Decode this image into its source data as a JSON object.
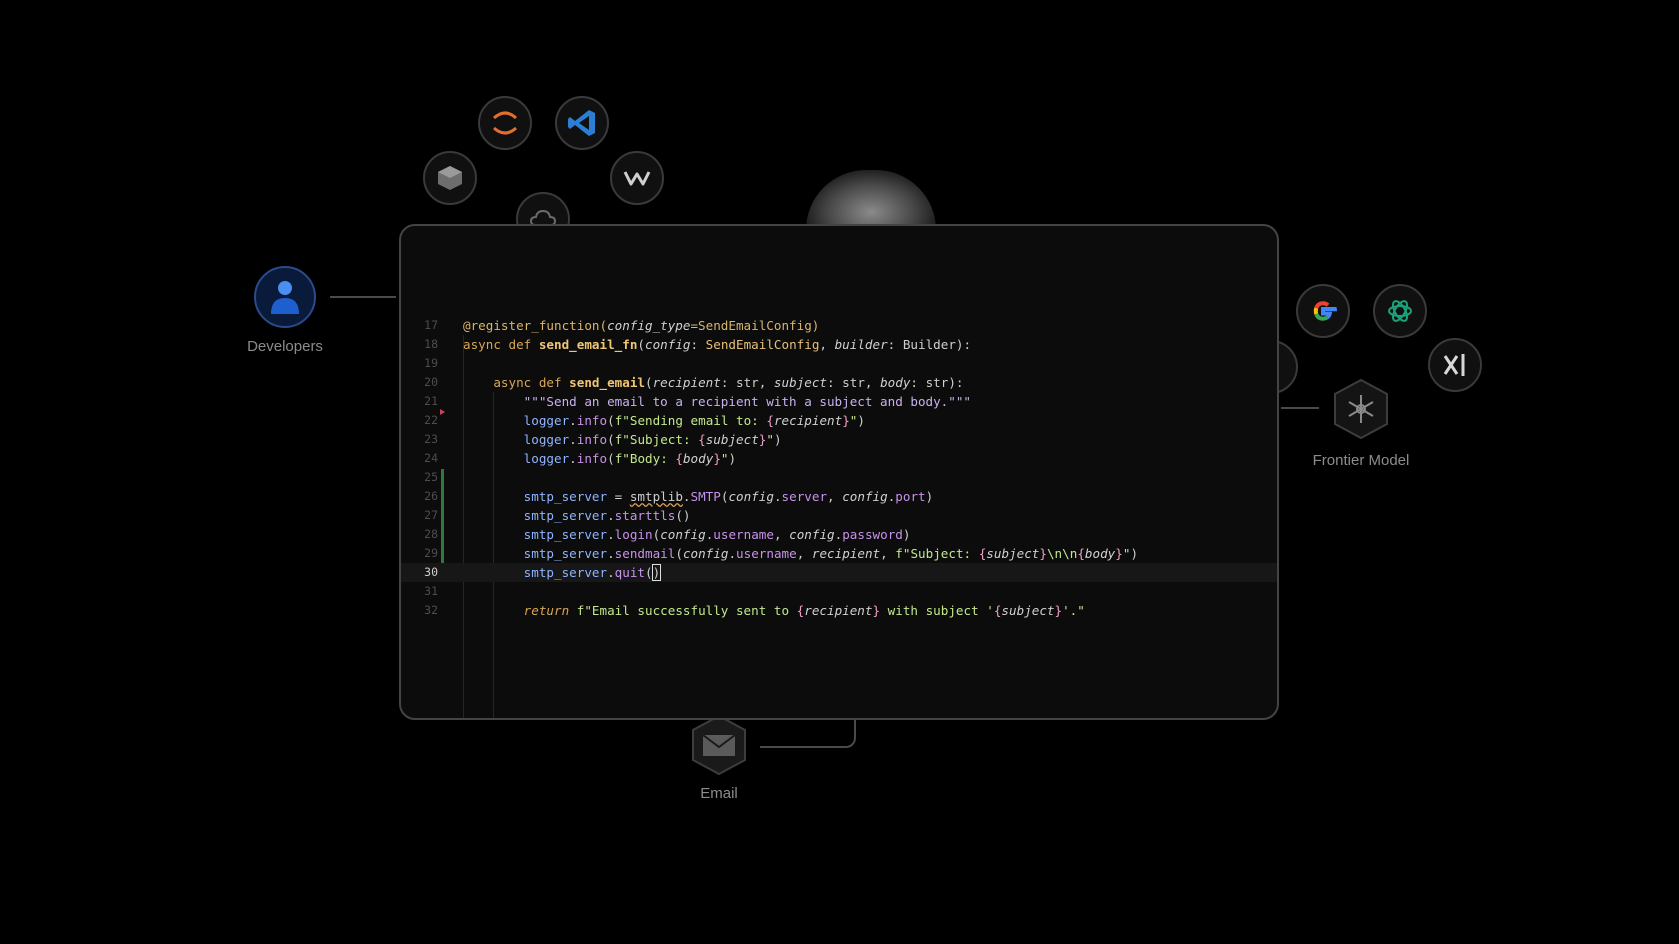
{
  "nodes": {
    "developers": "Developers",
    "frontier_model": "Frontier Model",
    "email": "Email"
  },
  "editor": {
    "lines": [
      {
        "n": "17",
        "tokens": [
          [
            "k-dec",
            "@register_function("
          ],
          [
            "k-par",
            "config_type"
          ],
          [
            "k-dec",
            "=SendEmailConfig)"
          ]
        ]
      },
      {
        "n": "18",
        "tokens": [
          [
            "k-kw",
            "async def "
          ],
          [
            "k-fn",
            "send_email_fn"
          ],
          [
            "k-def",
            "("
          ],
          [
            "k-par",
            "config"
          ],
          [
            "k-def",
            ": "
          ],
          [
            "k-cls",
            "SendEmailConfig"
          ],
          [
            "k-def",
            ", "
          ],
          [
            "k-par",
            "builder"
          ],
          [
            "k-def",
            ": Builder):"
          ]
        ]
      },
      {
        "n": "19",
        "tokens": []
      },
      {
        "n": "20",
        "tokens": [
          [
            "k-def",
            "    "
          ],
          [
            "k-kw",
            "async def "
          ],
          [
            "k-fn",
            "send_email"
          ],
          [
            "k-def",
            "("
          ],
          [
            "k-par",
            "recipient"
          ],
          [
            "k-def",
            ": str, "
          ],
          [
            "k-par",
            "subject"
          ],
          [
            "k-def",
            ": str, "
          ],
          [
            "k-par",
            "body"
          ],
          [
            "k-def",
            ": str):"
          ]
        ]
      },
      {
        "n": "21",
        "tokens": [
          [
            "k-def",
            "        "
          ],
          [
            "k-doc",
            "\"\"\"Send an email to a recipient with a subject and body.\"\"\""
          ]
        ]
      },
      {
        "n": "22",
        "tokens": [
          [
            "k-def",
            "        "
          ],
          [
            "k-var",
            "logger"
          ],
          [
            "k-def",
            "."
          ],
          [
            "k-mem",
            "info"
          ],
          [
            "k-def",
            "("
          ],
          [
            "k-str",
            "f\"Sending email to: "
          ],
          [
            "k-br",
            "{"
          ],
          [
            "k-par",
            "recipient"
          ],
          [
            "k-br",
            "}"
          ],
          [
            "k-str",
            "\""
          ],
          [
            "k-def",
            ")"
          ]
        ]
      },
      {
        "n": "23",
        "tokens": [
          [
            "k-def",
            "        "
          ],
          [
            "k-var",
            "logger"
          ],
          [
            "k-def",
            "."
          ],
          [
            "k-mem",
            "info"
          ],
          [
            "k-def",
            "("
          ],
          [
            "k-str",
            "f\"Subject: "
          ],
          [
            "k-br",
            "{"
          ],
          [
            "k-par",
            "subject"
          ],
          [
            "k-br",
            "}"
          ],
          [
            "k-str",
            "\""
          ],
          [
            "k-def",
            ")"
          ]
        ]
      },
      {
        "n": "24",
        "tokens": [
          [
            "k-def",
            "        "
          ],
          [
            "k-var",
            "logger"
          ],
          [
            "k-def",
            "."
          ],
          [
            "k-mem",
            "info"
          ],
          [
            "k-def",
            "("
          ],
          [
            "k-str",
            "f\"Body: "
          ],
          [
            "k-br",
            "{"
          ],
          [
            "k-par",
            "body"
          ],
          [
            "k-br",
            "}"
          ],
          [
            "k-str",
            "\""
          ],
          [
            "k-def",
            ")"
          ]
        ]
      },
      {
        "n": "25",
        "tokens": []
      },
      {
        "n": "26",
        "tokens": [
          [
            "k-def",
            "        "
          ],
          [
            "k-var",
            "smtp_server"
          ],
          [
            "k-def",
            " = "
          ],
          [
            "k-sq",
            "smtplib"
          ],
          [
            "k-def",
            "."
          ],
          [
            "k-mem",
            "SMTP"
          ],
          [
            "k-def",
            "("
          ],
          [
            "k-par",
            "config"
          ],
          [
            "k-def",
            "."
          ],
          [
            "k-mem",
            "server"
          ],
          [
            "k-def",
            ", "
          ],
          [
            "k-par",
            "config"
          ],
          [
            "k-def",
            "."
          ],
          [
            "k-mem",
            "port"
          ],
          [
            "k-def",
            ")"
          ]
        ]
      },
      {
        "n": "27",
        "tokens": [
          [
            "k-def",
            "        "
          ],
          [
            "k-var",
            "smtp_server"
          ],
          [
            "k-def",
            "."
          ],
          [
            "k-mem",
            "starttls"
          ],
          [
            "k-def",
            "()"
          ]
        ]
      },
      {
        "n": "28",
        "tokens": [
          [
            "k-def",
            "        "
          ],
          [
            "k-var",
            "smtp_server"
          ],
          [
            "k-def",
            "."
          ],
          [
            "k-mem",
            "login"
          ],
          [
            "k-def",
            "("
          ],
          [
            "k-par",
            "config"
          ],
          [
            "k-def",
            "."
          ],
          [
            "k-mem",
            "username"
          ],
          [
            "k-def",
            ", "
          ],
          [
            "k-par",
            "config"
          ],
          [
            "k-def",
            "."
          ],
          [
            "k-mem",
            "password"
          ],
          [
            "k-def",
            ")"
          ]
        ]
      },
      {
        "n": "29",
        "tokens": [
          [
            "k-def",
            "        "
          ],
          [
            "k-var",
            "smtp_server"
          ],
          [
            "k-def",
            "."
          ],
          [
            "k-mem",
            "sendmail"
          ],
          [
            "k-def",
            "("
          ],
          [
            "k-par",
            "config"
          ],
          [
            "k-def",
            "."
          ],
          [
            "k-mem",
            "username"
          ],
          [
            "k-def",
            ", "
          ],
          [
            "k-par",
            "recipient"
          ],
          [
            "k-def",
            ", "
          ],
          [
            "k-str",
            "f\"Subject: "
          ],
          [
            "k-br",
            "{"
          ],
          [
            "k-par",
            "subject"
          ],
          [
            "k-br",
            "}"
          ],
          [
            "k-str",
            "\\n\\n"
          ],
          [
            "k-br",
            "{"
          ],
          [
            "k-par",
            "body"
          ],
          [
            "k-br",
            "}"
          ],
          [
            "k-str",
            "\""
          ],
          [
            "k-def",
            ")"
          ]
        ]
      },
      {
        "n": "30",
        "active": true,
        "tokens": [
          [
            "k-def",
            "        "
          ],
          [
            "k-var",
            "smtp_server"
          ],
          [
            "k-def",
            "."
          ],
          [
            "k-mem",
            "quit"
          ],
          [
            "k-def",
            "("
          ],
          [
            "cursor",
            ")"
          ]
        ]
      },
      {
        "n": "31",
        "tokens": []
      },
      {
        "n": "32",
        "tokens": [
          [
            "k-def",
            "        "
          ],
          [
            "k-ret",
            "return "
          ],
          [
            "k-str",
            "f\"Email successfully sent to "
          ],
          [
            "k-br",
            "{"
          ],
          [
            "k-par",
            "recipient"
          ],
          [
            "k-br",
            "}"
          ],
          [
            "k-str",
            " with subject '"
          ],
          [
            "k-br",
            "{"
          ],
          [
            "k-par",
            "subject"
          ],
          [
            "k-br",
            "}"
          ],
          [
            "k-str",
            "'.\""
          ]
        ]
      }
    ]
  },
  "icons": {
    "jupyter": "jupyter-icon",
    "vscode": "vscode-icon",
    "cube": "cube-tool-icon",
    "windsurf": "windsurf-icon",
    "cloud": "cloud-icon",
    "google": "google-icon",
    "openai": "openai-icon",
    "xai": "xai-icon",
    "frontier": "frontier-model-icon",
    "email": "email-icon",
    "developers": "developer-icon"
  }
}
